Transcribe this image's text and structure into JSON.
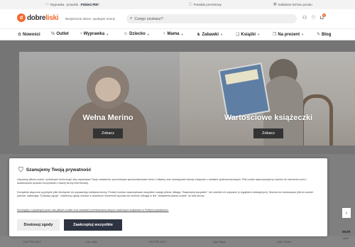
{
  "topbar": {
    "item1": "Wyprawka - poradnik",
    "item1_badge": "Pobierz PDF",
    "item2": "Poradnik prezentowy",
    "item3": "Kalkulator terminu porodu"
  },
  "header": {
    "logo_part1": "dobre",
    "logo_part2": "liski",
    "tagline": "Bezpieczne dzieci, spokojne mamy",
    "search_placeholder": "Czego szukasz?",
    "cart_count": "0"
  },
  "nav": {
    "items": [
      {
        "label": "Nowości"
      },
      {
        "label": "Outlet"
      },
      {
        "label": "Wyprawka"
      },
      {
        "label": "Dziecko"
      },
      {
        "label": "Mama"
      },
      {
        "label": "Zabawki"
      },
      {
        "label": "Książki"
      },
      {
        "label": "Na prezent"
      },
      {
        "label": "Blog"
      }
    ]
  },
  "banners": [
    {
      "title": "Wełna Merino",
      "button": "Zobacz"
    },
    {
      "title": "Wartościowe książeczki",
      "button": "Zobacz"
    }
  ],
  "cookie": {
    "title": "Szanujemy Twoją prywatność",
    "p1": "Używamy plików cookie i podobnych technologii, aby zapamiętać Twoje ustawienia, prezentować spersonalizowane treści i reklamy oraz udostępniać funkcje związane z mediami społecznościowymi. Pliki cookie wykorzystujemy również do mierzenia ruchu i analizowania sposobu korzystania z naszej strony internetowej.",
    "p2": "Domyślnie włączone są jedynie pliki niezbędne do poprawnego działania strony. Poniżej możesz zaakceptować wszystkie rodzaje plików, klikając \"Zaakceptuj wszystkie\", lub określić ich używanie (z wyjątkiem niezbędnych). Możesz też dostosować pliki do swoich potrzeb, wybierając \"Dostosuj zgody\". Udzieloną zgodę możesz w dowolnym momencie wycofać lub zmienić, klikając w link \"Ustawienia plików cookie\" na dole strony.",
    "link": "Szczegóły o używanych przez nas plikach cookie oraz zasadach przetwarzania danych osobowych znajdziesz w Polityce prywatności.",
    "btn_customize": "Dostosuj zgody",
    "btn_accept": "Zaakceptuj wszystkie"
  },
  "bottom": {
    "brands": [
      "HUTTELIHUT",
      "Lulu Jelly",
      "HUTTELIHUT",
      "Apo Rapo",
      "Little Dutch",
      "Lullai"
    ],
    "side_price": "59,99",
    "side_brand": "Lullal"
  },
  "icons": {
    "topbar1": "book-icon",
    "topbar2": "gift-icon",
    "topbar3": "calculator-icon",
    "search": "search-icon",
    "user": "user-icon",
    "heart": "heart-icon",
    "cart": "bag-icon",
    "shield": "shield-icon"
  },
  "colors": {
    "brand": "#f26a2e",
    "accept_button": "#2d3340"
  }
}
